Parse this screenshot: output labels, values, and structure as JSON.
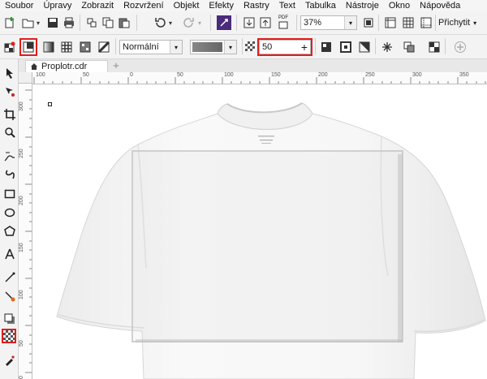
{
  "menu": [
    "Soubor",
    "Úpravy",
    "Zobrazit",
    "Rozvržení",
    "Objekt",
    "Efekty",
    "Rastry",
    "Text",
    "Tabulka",
    "Nástroje",
    "Okno",
    "Nápověda"
  ],
  "standard_toolbar": {
    "zoom_value": "37%",
    "snap_label": "Přichytit",
    "pdf_label": "PDF"
  },
  "property_bar": {
    "blend_mode": "Normální",
    "transparency_value": "50"
  },
  "document": {
    "tab_name": "Proplotr.cdr"
  },
  "ruler": {
    "h_ticks": [
      "100",
      "50",
      "0",
      "50",
      "100",
      "150",
      "200",
      "250",
      "300",
      "350"
    ],
    "v_ticks": [
      "300",
      "250",
      "200",
      "150",
      "100",
      "50",
      "0"
    ]
  },
  "colors": {
    "highlight": "#e01e1e",
    "toolbar_bg": "#f3f3f3",
    "canvas_bg": "#ffffff"
  }
}
